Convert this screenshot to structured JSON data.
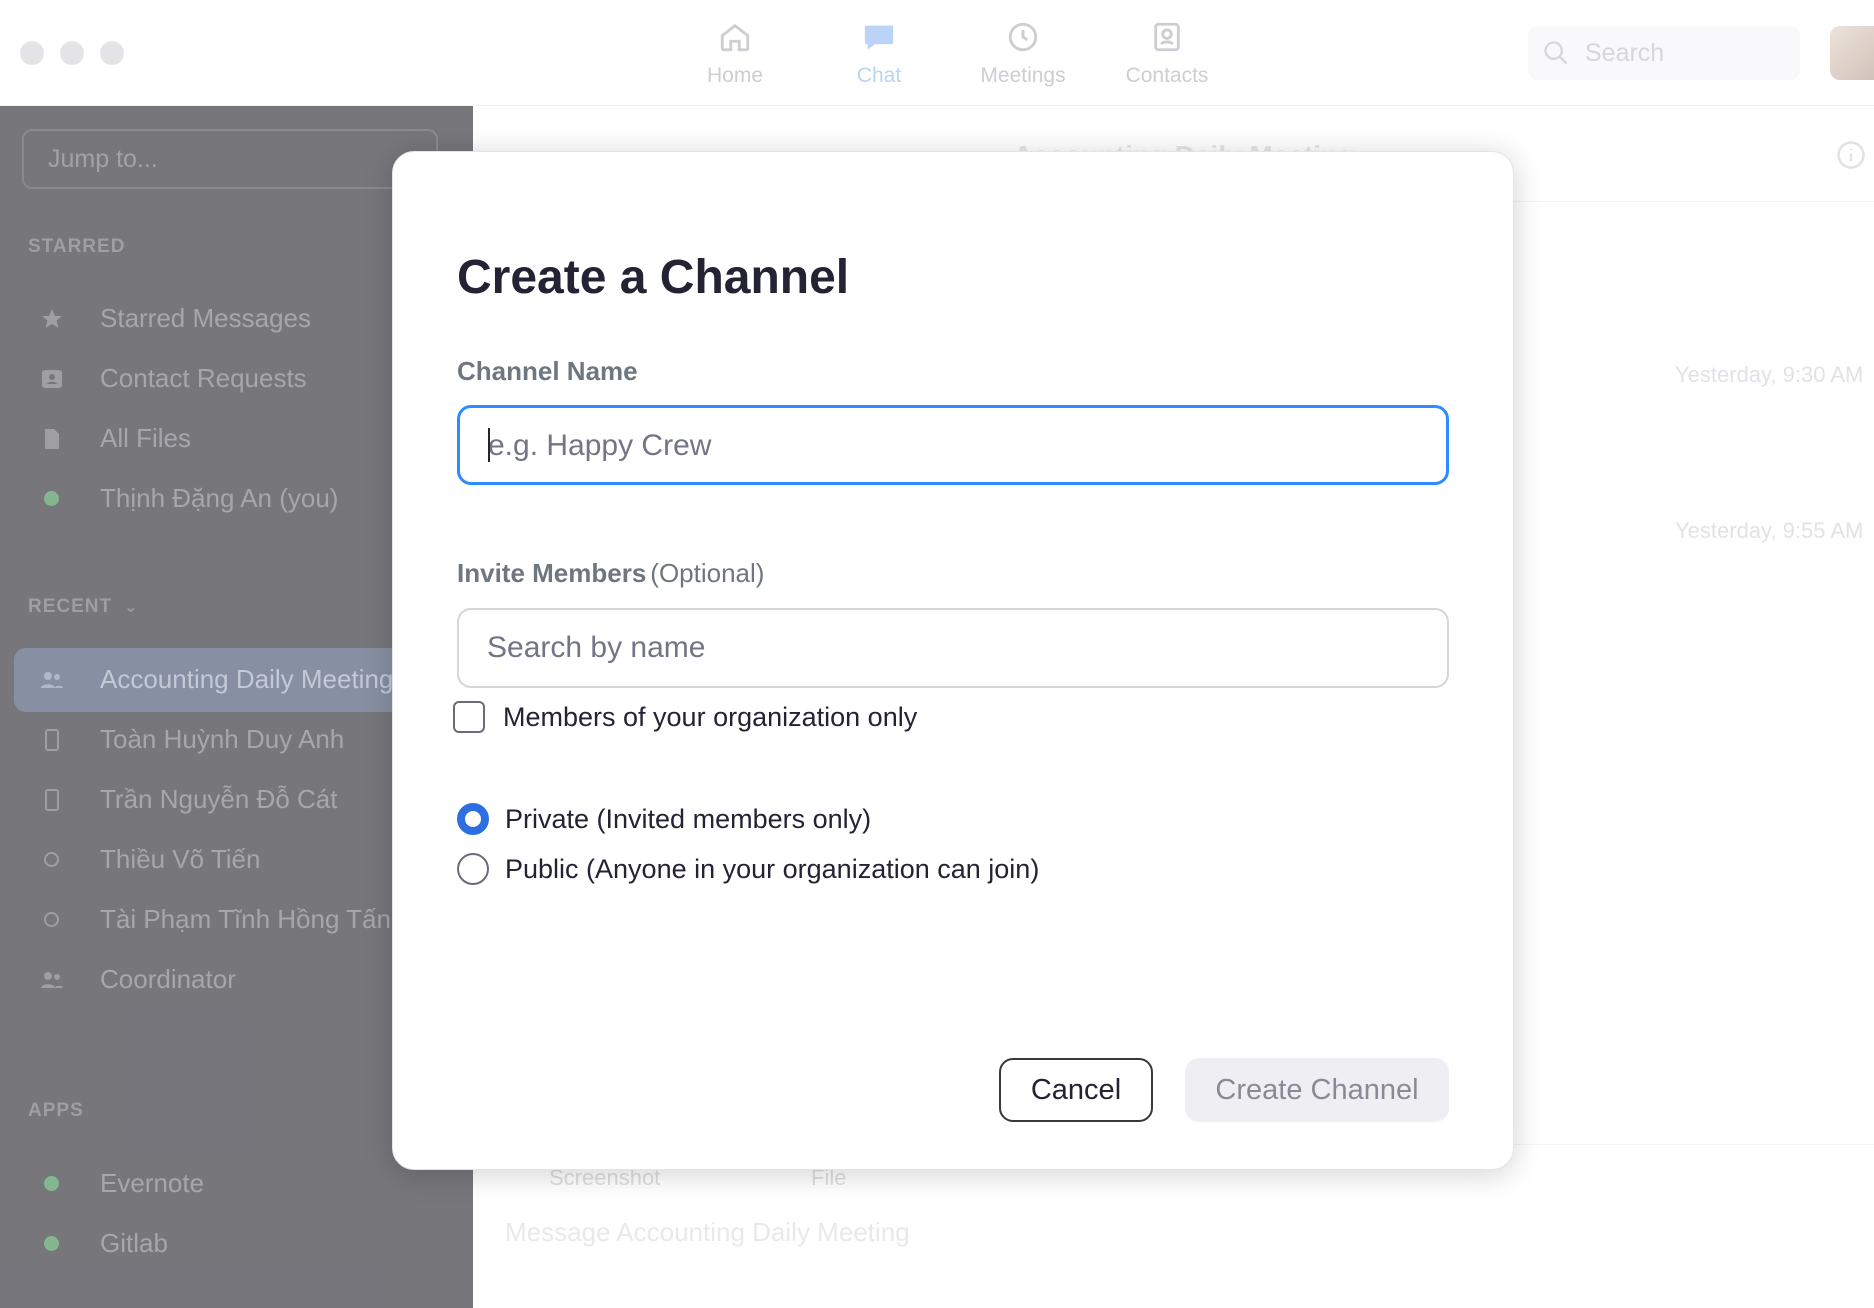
{
  "topbar": {
    "tabs": [
      {
        "label": "Home",
        "icon": "home-icon"
      },
      {
        "label": "Chat",
        "icon": "chat-icon",
        "active": true
      },
      {
        "label": "Meetings",
        "icon": "clock-icon"
      },
      {
        "label": "Contacts",
        "icon": "contacts-icon"
      }
    ],
    "search_placeholder": "Search"
  },
  "sidebar": {
    "jump_placeholder": "Jump to...",
    "starred_heading": "STARRED",
    "starred": [
      {
        "label": "Starred Messages",
        "icon": "star-icon"
      },
      {
        "label": "Contact Requests",
        "icon": "contact-card-icon"
      },
      {
        "label": "All Files",
        "icon": "file-icon"
      },
      {
        "label": "Thịnh Đặng An  (you)",
        "icon": "online-dot-icon"
      }
    ],
    "recent_heading": "RECENT",
    "recent": [
      {
        "label": "Accounting Daily Meeting",
        "icon": "group-icon",
        "active": true
      },
      {
        "label": "Toàn Huỳnh Duy Anh",
        "icon": "mobile-icon"
      },
      {
        "label": "Trần Nguyễn Đỗ Cát",
        "icon": "mobile-icon"
      },
      {
        "label": "Thiều Võ Tiến",
        "icon": "offline-dot-icon"
      },
      {
        "label": "Tài Phạm Tĩnh Hồng Tấn",
        "icon": "offline-dot-icon"
      },
      {
        "label": "Coordinator",
        "icon": "group-icon"
      }
    ],
    "apps_heading": "APPS",
    "apps": [
      {
        "label": "Evernote",
        "icon": "online-dot-icon"
      },
      {
        "label": "Gitlab",
        "icon": "online-dot-icon"
      }
    ]
  },
  "main": {
    "title": "Accounting Daily Meeting",
    "times": [
      "Yesterday, 9:30 AM",
      "Yesterday, 9:55 AM"
    ],
    "composer": {
      "screenshot_label": "Screenshot",
      "file_label": "File",
      "placeholder": "Message Accounting Daily Meeting"
    }
  },
  "dialog": {
    "title": "Create a Channel",
    "channel_name_label": "Channel Name",
    "channel_name_placeholder": "e.g. Happy Crew",
    "invite_label": "Invite Members",
    "invite_optional": "(Optional)",
    "invite_placeholder": "Search by name",
    "org_only_label": "Members of your organization only",
    "private_label": "Private (Invited members only)",
    "public_label": "Public (Anyone in your organization can join)",
    "cancel_label": "Cancel",
    "create_label": "Create Channel"
  },
  "colors": {
    "accent": "#2d8cff",
    "radio_selected": "#2d6fe0",
    "sidebar_bg": "#3b3b43"
  }
}
